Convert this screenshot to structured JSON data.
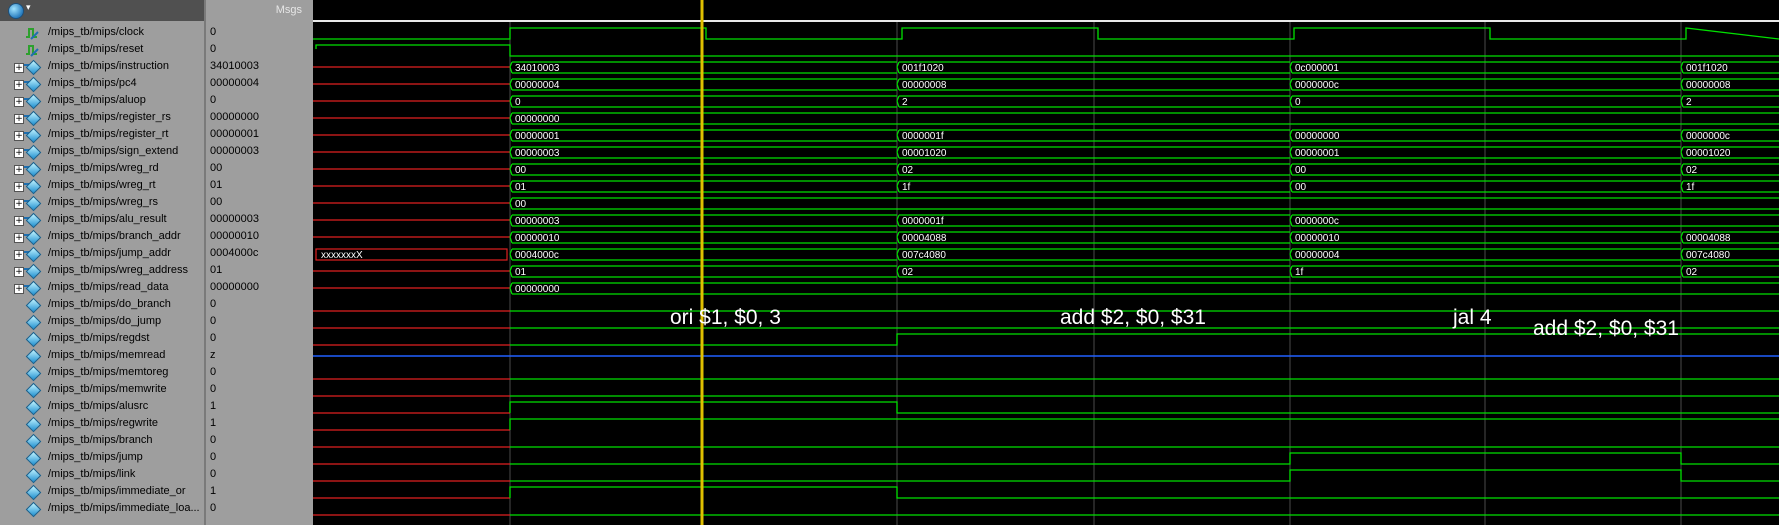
{
  "header": {
    "msgs_label": "Msgs"
  },
  "signals": [
    {
      "name": "/mips_tb/mips/clock",
      "value": "0",
      "kind": "clock",
      "expandable": false
    },
    {
      "name": "/mips_tb/mips/reset",
      "value": "0",
      "kind": "clock",
      "expandable": false
    },
    {
      "name": "/mips_tb/mips/instruction",
      "value": "34010003",
      "kind": "bus",
      "expandable": true
    },
    {
      "name": "/mips_tb/mips/pc4",
      "value": "00000004",
      "kind": "bus",
      "expandable": true
    },
    {
      "name": "/mips_tb/mips/aluop",
      "value": "0",
      "kind": "bus",
      "expandable": true
    },
    {
      "name": "/mips_tb/mips/register_rs",
      "value": "00000000",
      "kind": "bus",
      "expandable": true
    },
    {
      "name": "/mips_tb/mips/register_rt",
      "value": "00000001",
      "kind": "bus",
      "expandable": true
    },
    {
      "name": "/mips_tb/mips/sign_extend",
      "value": "00000003",
      "kind": "bus",
      "expandable": true
    },
    {
      "name": "/mips_tb/mips/wreg_rd",
      "value": "00",
      "kind": "bus",
      "expandable": true
    },
    {
      "name": "/mips_tb/mips/wreg_rt",
      "value": "01",
      "kind": "bus",
      "expandable": true
    },
    {
      "name": "/mips_tb/mips/wreg_rs",
      "value": "00",
      "kind": "bus",
      "expandable": true
    },
    {
      "name": "/mips_tb/mips/alu_result",
      "value": "00000003",
      "kind": "bus",
      "expandable": true
    },
    {
      "name": "/mips_tb/mips/branch_addr",
      "value": "00000010",
      "kind": "bus",
      "expandable": true
    },
    {
      "name": "/mips_tb/mips/jump_addr",
      "value": "0004000c",
      "kind": "bus",
      "expandable": true
    },
    {
      "name": "/mips_tb/mips/wreg_address",
      "value": "01",
      "kind": "bus",
      "expandable": true
    },
    {
      "name": "/mips_tb/mips/read_data",
      "value": "00000000",
      "kind": "bus",
      "expandable": true
    },
    {
      "name": "/mips_tb/mips/do_branch",
      "value": "0",
      "kind": "bit",
      "expandable": false
    },
    {
      "name": "/mips_tb/mips/do_jump",
      "value": "0",
      "kind": "bit",
      "expandable": false
    },
    {
      "name": "/mips_tb/mips/regdst",
      "value": "0",
      "kind": "bit",
      "expandable": false
    },
    {
      "name": "/mips_tb/mips/memread",
      "value": "z",
      "kind": "bit",
      "expandable": false
    },
    {
      "name": "/mips_tb/mips/memtoreg",
      "value": "0",
      "kind": "bit",
      "expandable": false
    },
    {
      "name": "/mips_tb/mips/memwrite",
      "value": "0",
      "kind": "bit",
      "expandable": false
    },
    {
      "name": "/mips_tb/mips/alusrc",
      "value": "1",
      "kind": "bit",
      "expandable": false
    },
    {
      "name": "/mips_tb/mips/regwrite",
      "value": "1",
      "kind": "bit",
      "expandable": false
    },
    {
      "name": "/mips_tb/mips/branch",
      "value": "0",
      "kind": "bit",
      "expandable": false
    },
    {
      "name": "/mips_tb/mips/jump",
      "value": "0",
      "kind": "bit",
      "expandable": false
    },
    {
      "name": "/mips_tb/mips/link",
      "value": "0",
      "kind": "bit",
      "expandable": false
    },
    {
      "name": "/mips_tb/mips/immediate_or",
      "value": "1",
      "kind": "bit",
      "expandable": false
    },
    {
      "name": "/mips_tb/mips/immediate_loa...",
      "value": "0",
      "kind": "bit",
      "expandable": false
    }
  ],
  "bus_values": {
    "instruction": [
      "34010003",
      "001f1020",
      "0c000001",
      "001f1020"
    ],
    "pc4": [
      "00000004",
      "00000008",
      "0000000c",
      "00000008"
    ],
    "aluop": [
      "0",
      "2",
      "0",
      "2"
    ],
    "register_rs": [
      "00000000"
    ],
    "register_rt": [
      "00000001",
      "0000001f",
      "00000000",
      "0000000c"
    ],
    "sign_extend": [
      "00000003",
      "00001020",
      "00000001",
      "00001020"
    ],
    "wreg_rd": [
      "00",
      "02",
      "00",
      "02"
    ],
    "wreg_rt": [
      "01",
      "1f",
      "00",
      "1f"
    ],
    "wreg_rs": [
      "00"
    ],
    "alu_result": [
      "00000003",
      "0000001f",
      "0000000c"
    ],
    "branch_addr": [
      "00000010",
      "00004088",
      "00000010",
      "00004088"
    ],
    "jump_addr_pre": "xxxxxxxX",
    "jump_addr": [
      "0004000c",
      "007c4080",
      "00000004",
      "007c4080"
    ],
    "wreg_address": [
      "01",
      "02",
      "1f",
      "02"
    ],
    "read_data": [
      "00000000"
    ]
  },
  "bit_levels": {
    "do_branch": [
      0,
      0,
      0,
      0
    ],
    "do_jump": [
      0,
      0,
      0,
      0
    ],
    "regdst": [
      0,
      1,
      1,
      1
    ],
    "memtoreg": [
      0,
      0,
      0,
      0
    ],
    "memwrite": [
      0,
      0,
      0,
      0
    ],
    "alusrc": [
      1,
      0,
      0,
      0
    ],
    "regwrite": [
      1,
      1,
      1,
      1
    ],
    "branch": [
      0,
      0,
      0,
      0
    ],
    "jump": [
      0,
      0,
      1,
      0
    ],
    "link": [
      0,
      0,
      1,
      0
    ],
    "immediate_or": [
      1,
      0,
      0,
      0
    ],
    "immediate_loa": [
      0,
      0,
      0,
      0
    ]
  },
  "annotations": [
    {
      "text": "ori $1, $0, 3",
      "level": 0
    },
    {
      "text": "add $2, $0, $31",
      "level": 0
    },
    {
      "text": "jal 4",
      "level": 0
    },
    {
      "text": "add $2, $0, $31",
      "level": 1
    }
  ],
  "colors": {
    "wave": "#00e000",
    "undefined": "#e02020",
    "highz": "#2060ff",
    "cursor": "#e0c000"
  }
}
